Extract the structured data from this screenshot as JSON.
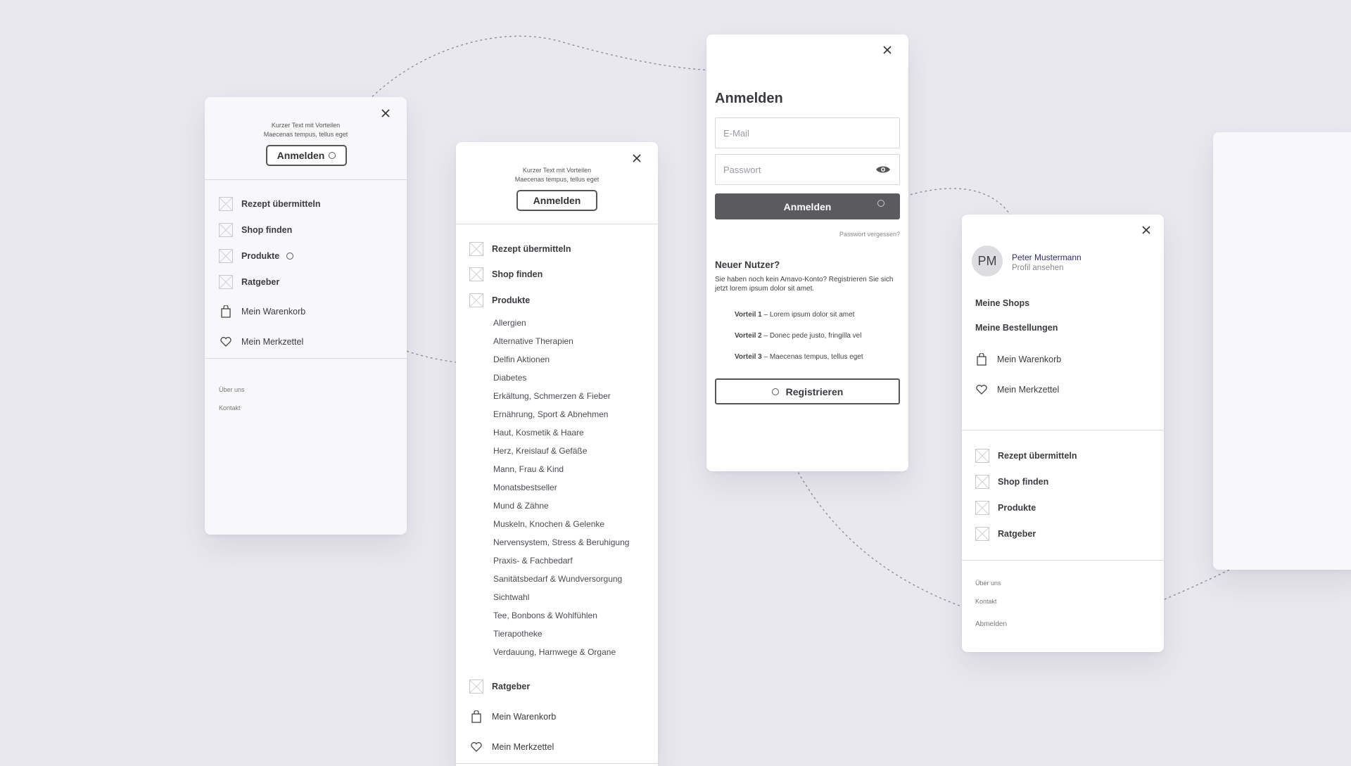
{
  "menu_guest": {
    "promo_line1": "Kurzer Text mit Vorteilen",
    "promo_line2": "Maecenas tempus, tellus eget",
    "login_label": "Anmelden",
    "items": [
      {
        "label": "Rezept übermitteln",
        "icon": "placeholder-icon"
      },
      {
        "label": "Shop finden",
        "icon": "placeholder-icon"
      },
      {
        "label": "Produkte",
        "icon": "placeholder-icon"
      },
      {
        "label": "Ratgeber",
        "icon": "placeholder-icon"
      },
      {
        "label": "Mein Warenkorb",
        "icon": "bag-icon"
      },
      {
        "label": "Mein Merkzettel",
        "icon": "heart-icon"
      }
    ],
    "footer_links": [
      "Über uns",
      "Kontakt"
    ]
  },
  "menu_products": {
    "promo_line1": "Kurzer Text mit Vorteilen",
    "promo_line2": "Maecenas tempus, tellus eget",
    "login_label": "Anmelden",
    "items_top": [
      {
        "label": "Rezept übermitteln",
        "icon": "placeholder-icon"
      },
      {
        "label": "Shop finden",
        "icon": "placeholder-icon"
      },
      {
        "label": "Produkte",
        "icon": "placeholder-icon"
      }
    ],
    "subcategories": [
      "Allergien",
      "Alternative Therapien",
      "Delfin Aktionen",
      "Diabetes",
      "Erkältung, Schmerzen & Fieber",
      "Ernährung, Sport & Abnehmen",
      "Haut, Kosmetik & Haare",
      "Herz, Kreislauf & Gefäße",
      "Mann, Frau & Kind",
      "Monatsbestseller",
      "Mund & Zähne",
      "Muskeln, Knochen & Gelenke",
      "Nervensystem, Stress & Beruhigung",
      "Praxis- & Fachbedarf",
      "Sanitätsbedarf & Wundversorgung",
      "Sichtwahl",
      "Tee, Bonbons & Wohlfühlen",
      "Tierapotheke",
      "Verdauung, Harnwege & Organe"
    ],
    "items_bottom": [
      {
        "label": "Ratgeber",
        "icon": "placeholder-icon"
      },
      {
        "label": "Mein Warenkorb",
        "icon": "bag-icon"
      },
      {
        "label": "Mein Merkzettel",
        "icon": "heart-icon"
      }
    ]
  },
  "login": {
    "title": "Anmelden",
    "email_placeholder": "E-Mail",
    "password_placeholder": "Passwort",
    "submit_label": "Anmelden",
    "forgot_label": "Passwort vergessen?",
    "new_user_title": "Neuer Nutzer?",
    "new_user_text": "Sie haben noch kein Amavo-Konto? Registrieren Sie sich jetzt lorem ipsum dolor sit amet.",
    "benefits": [
      {
        "bold": "Vorteil 1",
        "text": " – Lorem ipsum dolor sit amet"
      },
      {
        "bold": "Vorteil 2",
        "text": " – Donec pede justo, fringilla vel"
      },
      {
        "bold": "Vorteil 3",
        "text": " – Maecenas tempus, tellus eget"
      }
    ],
    "register_label": "Registrieren"
  },
  "menu_user": {
    "initials": "PM",
    "name": "Peter Mustermann",
    "profile_link": "Profil ansehen",
    "account_items": [
      "Meine Shops",
      "Meine Bestellungen"
    ],
    "items_icons": [
      {
        "label": "Mein Warenkorb",
        "icon": "bag-icon"
      },
      {
        "label": "Mein Merkzettel",
        "icon": "heart-icon"
      }
    ],
    "items_nav": [
      {
        "label": "Rezept übermitteln",
        "icon": "placeholder-icon"
      },
      {
        "label": "Shop finden",
        "icon": "placeholder-icon"
      },
      {
        "label": "Produkte",
        "icon": "placeholder-icon"
      },
      {
        "label": "Ratgeber",
        "icon": "placeholder-icon"
      }
    ],
    "footer_links": [
      "Über uns",
      "Kontakt"
    ],
    "logout_label": "Abmelden"
  },
  "colors": {
    "background": "#e9e8ef",
    "primary_button": "#5a5a5f",
    "user_name": "#2d2c6e"
  }
}
